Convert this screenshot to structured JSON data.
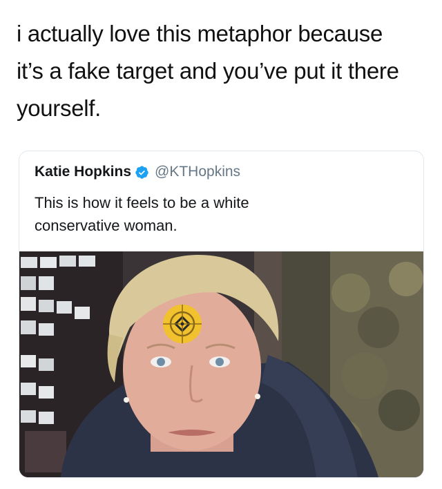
{
  "caption": {
    "lines": [
      "i actually love this metaphor because",
      "it’s a fake target and you’ve put it there",
      "yourself."
    ]
  },
  "quoted_tweet": {
    "author_name": "Katie Hopkins",
    "handle": "@KTHopkins",
    "verified": true,
    "verified_icon": "verified-badge-icon",
    "text_lines": [
      "This is how it feels to be a white",
      "conservative woman."
    ],
    "photo": {
      "description_icon": "photo-woman-with-target-sticker",
      "sticker_color": "#f2c12e"
    }
  }
}
